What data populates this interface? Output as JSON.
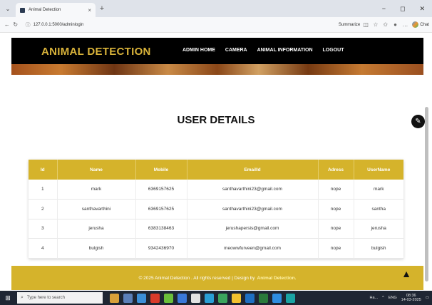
{
  "browser": {
    "tab_title": "Animal Detection",
    "tab_close": "×",
    "new_tab": "+",
    "window_controls": [
      "−",
      "◻",
      "✕"
    ],
    "url": "127.0.0.1:5000/adminlogin",
    "summarize": "Summarize",
    "chat": "Chat"
  },
  "site": {
    "brand": "ANIMAL DETECTION",
    "nav": [
      "ADMIN HOME",
      "CAMERA",
      "ANIMAL INFORMATION",
      "LOGOUT"
    ]
  },
  "page": {
    "title": "USER DETAILS"
  },
  "table": {
    "headers": [
      "Id",
      "Name",
      "Mobile",
      "EmailId",
      "Adress",
      "UserName"
    ],
    "rows": [
      [
        "1",
        "mark",
        "6369157625",
        "santhavarthini23@gmail.com",
        "nope",
        "mark"
      ],
      [
        "2",
        "santhavarthini",
        "6369157625",
        "santhavarthini23@gmail.com",
        "nope",
        "santha"
      ],
      [
        "3",
        "jerusha",
        "6383138463",
        "jerushapersis@gmail.com",
        "nope",
        "jerusha"
      ],
      [
        "4",
        "bulgish",
        "9342436970",
        "meowwfurveen@gmail.com",
        "nope",
        "bulgish"
      ]
    ]
  },
  "footer": {
    "text": "© 2025 Animal Detection . All rights reserved | Design by",
    "link": "Animal Detection."
  },
  "taskbar": {
    "search_placeholder": "Type here to search",
    "tray_lang": "ENG",
    "tray_weather": "Ha...",
    "time": "08:36",
    "date": "14-03-2025"
  },
  "colors": {
    "accent_gold": "#d5b32b",
    "brand_text": "#d9b33a",
    "header_bg": "#000000"
  }
}
